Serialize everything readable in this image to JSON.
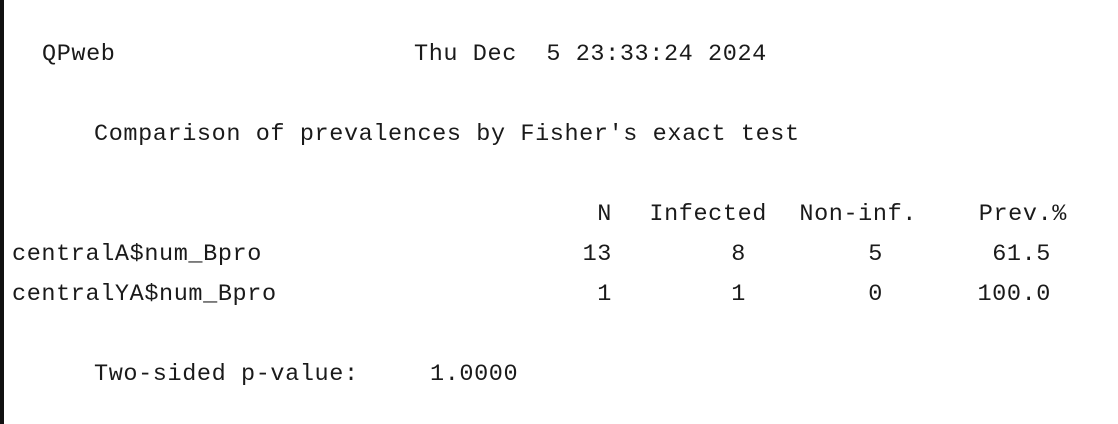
{
  "header": {
    "app_name": "QPweb",
    "timestamp": "Thu Dec  5 23:33:24 2024"
  },
  "test_title": "Comparison of prevalences by Fisher's exact test",
  "table": {
    "columns": [
      "N",
      "Infected",
      "Non-inf.",
      "Prev.%"
    ],
    "rows": [
      {
        "label": "centralA$num_Bpro",
        "n": "13",
        "infected": "8",
        "noninf": "5",
        "prev": "61.5"
      },
      {
        "label": "centralYA$num_Bpro",
        "n": "1",
        "infected": "1",
        "noninf": "0",
        "prev": "100.0"
      }
    ]
  },
  "result": {
    "label": "Two-sided p-value:",
    "value": "1.0000"
  }
}
